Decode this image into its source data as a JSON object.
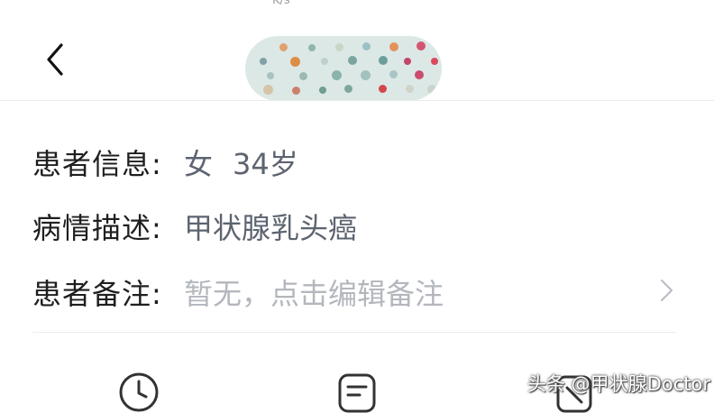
{
  "status_bar": {
    "speed": "K/s"
  },
  "header": {
    "back_icon": "chevron-left-icon"
  },
  "patient": {
    "info_label": "患者信息:",
    "gender": "女",
    "age": "34岁",
    "condition_label": "病情描述:",
    "condition": "甲状腺乳头癌",
    "note_label": "患者备注:",
    "note_placeholder": "暂无，点击编辑备注"
  },
  "bottom_icons": [
    "clock-icon",
    "document-icon",
    "record-icon"
  ],
  "watermark": "头条 @甲状腺Doctor",
  "colors": {
    "label": "#1f1f1f",
    "value": "#5d6470",
    "placeholder": "#b3b7bd"
  }
}
